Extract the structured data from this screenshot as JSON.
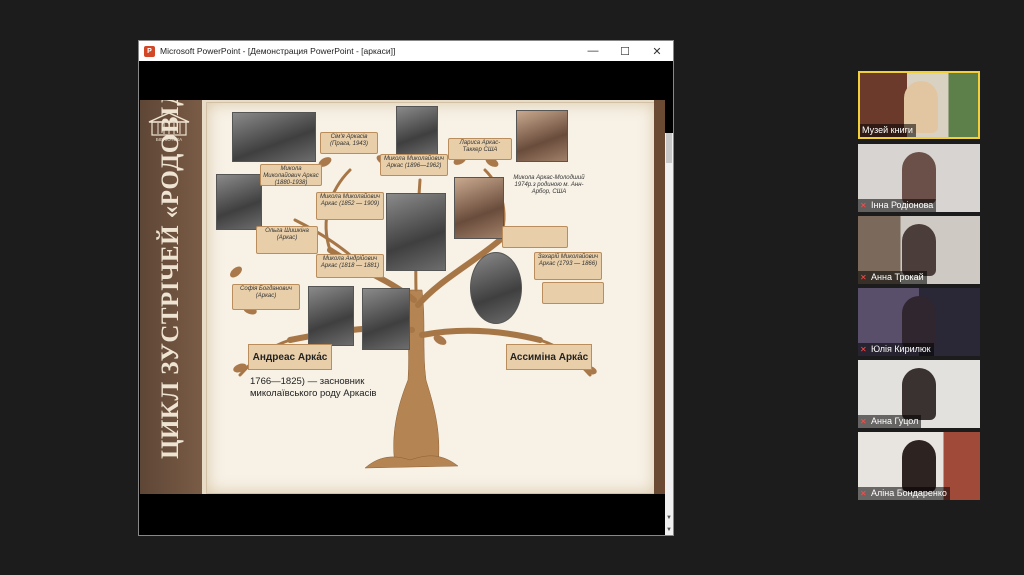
{
  "window": {
    "app_icon": "P",
    "title": "Microsoft PowerPoint - [Демонстрация PowerPoint - [аркаси]]",
    "minimize": "—",
    "maximize": "☐",
    "close": "✕"
  },
  "slide": {
    "side_title": "ЦИКЛ ЗУСТРІЧЕЙ «РОДОВІД»",
    "logo_text": "БІБЛІОТЕКА",
    "labels": {
      "simya": "Сім'я Аркасів (Прага, 1943)",
      "mykola_1": "Микола Миколайович Аркас (1880-1938)",
      "mykola_2": "Микола Миколайович Аркас (1896—1962)",
      "larysa": "Лариса Аркас-Таккер США",
      "mykola_3": "Микола Миколайович Аркас (1852 — 1909)",
      "mykola_young": "Микола Аркас-Молодший 1974р.з родиною м. Анн-Арбор, США",
      "olga": "Ольга Шишкіна (Аркас)",
      "mykola_andr": "Микола Андрійович Аркас (1818 — 1881)",
      "zakhar": "Захарій Миколайович Аркас (1793 — 1866)",
      "sofia": "Софія Богданович (Аркас)"
    },
    "founder": "Андреас Арка́с",
    "assymina": "Ассиміна Арка́с",
    "founder_note": "1766—1825) — засновник миколаївського роду Аркасів"
  },
  "participants": [
    {
      "name": "Музей книги",
      "muted": false
    },
    {
      "name": "Інна Родіонова",
      "muted": true
    },
    {
      "name": "Анна Трокай",
      "muted": true
    },
    {
      "name": "Юлія Кирилюк",
      "muted": true
    },
    {
      "name": "Анна Гуцол",
      "muted": true
    },
    {
      "name": "Аліна Бондаренко",
      "muted": true
    }
  ],
  "icons": {
    "muted": "mic-off-icon"
  }
}
